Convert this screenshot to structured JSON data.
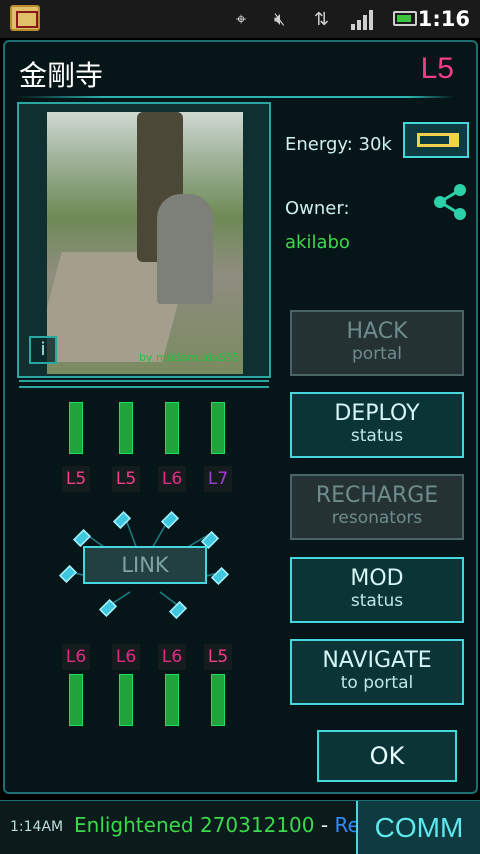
{
  "status_bar": {
    "time": "1:16",
    "icons": [
      "mail-icon",
      "gps-icon",
      "mute-icon",
      "data-arrows-icon",
      "signal-icon",
      "battery-icon"
    ]
  },
  "portal": {
    "name": "金剛寺",
    "level": "L5",
    "photo_caption": "by mudamudaS55",
    "energy_label": "Energy:",
    "energy_value": "30k",
    "owner_label": "Owner:",
    "owner_name": "akilabo"
  },
  "actions": {
    "hack": {
      "line1": "HACK",
      "line2": "portal",
      "enabled": false
    },
    "deploy": {
      "line1": "DEPLOY",
      "line2": "status",
      "enabled": true
    },
    "recharge": {
      "line1": "RECHARGE",
      "line2": "resonators",
      "enabled": false
    },
    "mod": {
      "line1": "MOD",
      "line2": "status",
      "enabled": true
    },
    "navigate": {
      "line1": "NAVIGATE",
      "line2": "to portal",
      "enabled": true
    },
    "ok": "OK",
    "link": "LINK"
  },
  "resonators": {
    "top": [
      "L5",
      "L5",
      "L6",
      "L7"
    ],
    "bottom": [
      "L6",
      "L6",
      "L6",
      "L5"
    ]
  },
  "comm": {
    "time": "1:14AM",
    "faction": "Enlightened",
    "score": "270312100",
    "separator": " - ",
    "rest": "Res",
    "button": "COMM"
  },
  "colors": {
    "accent": "#46d6dd",
    "enlightened": "#3adb4a",
    "resistance": "#2f8bff",
    "level": "#f33d8b"
  }
}
